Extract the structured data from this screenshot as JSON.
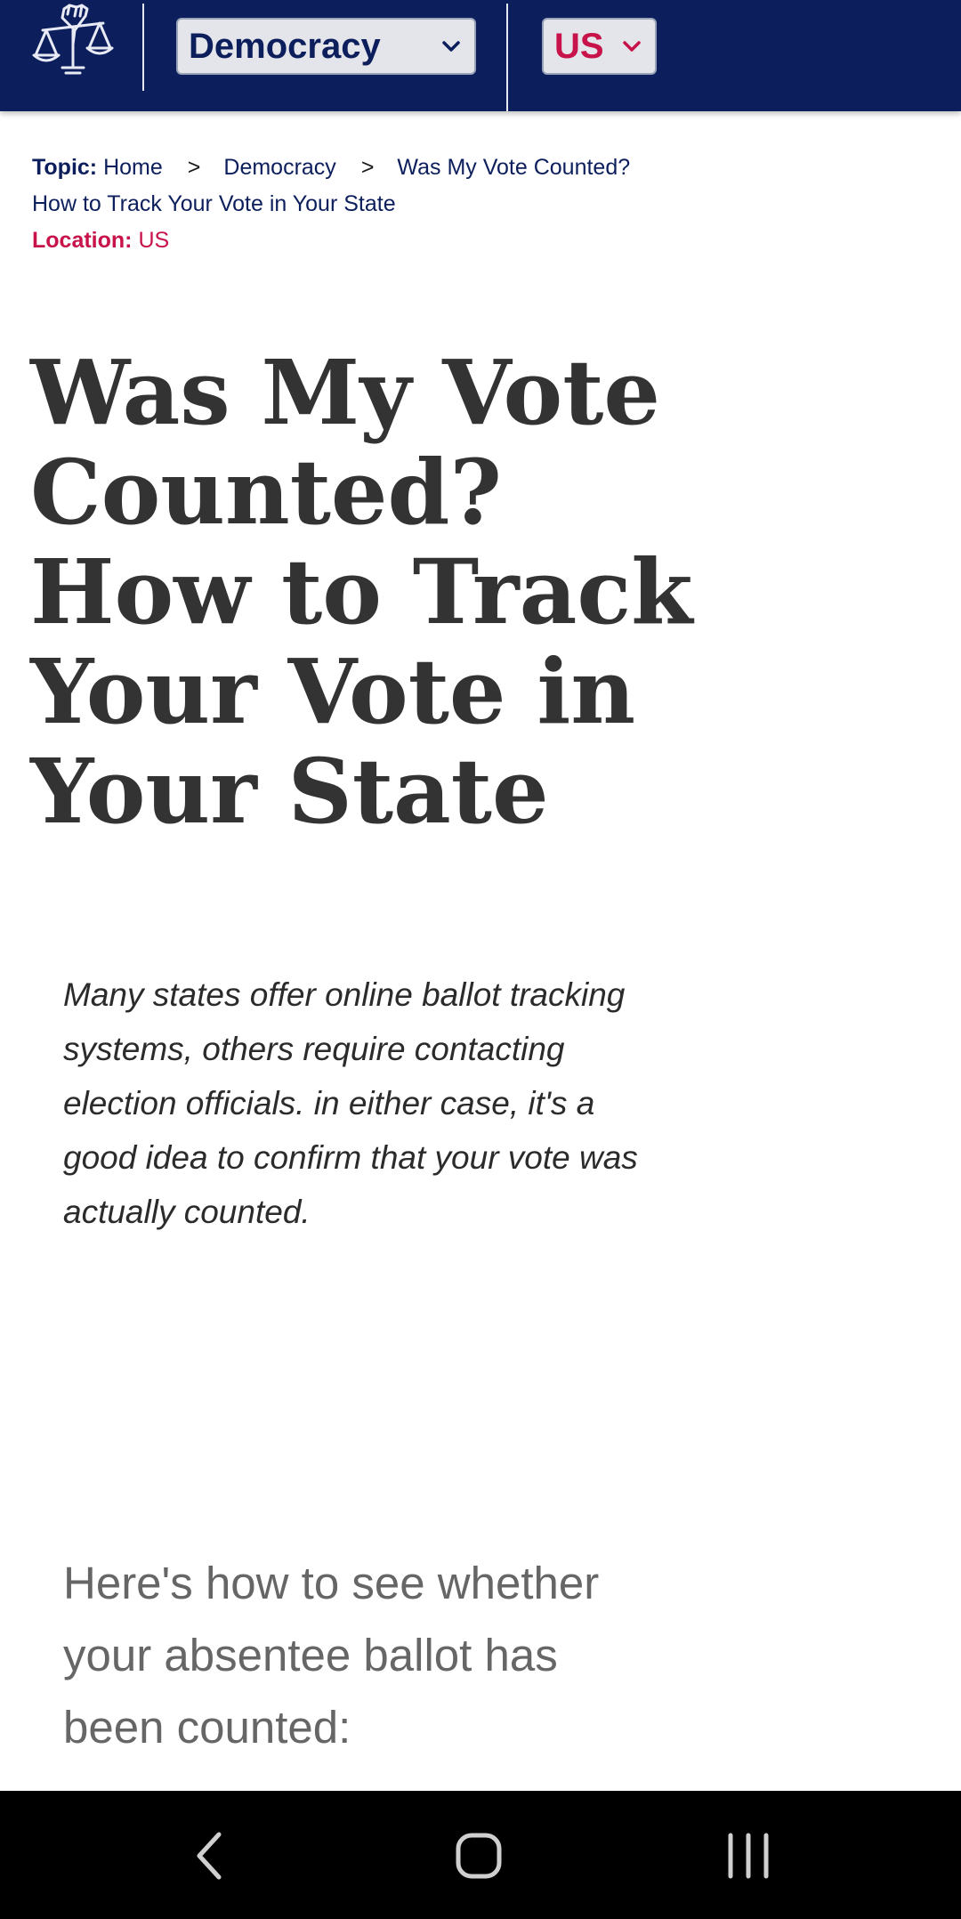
{
  "header": {
    "logo_icon": "scales-fist-icon",
    "topic_select": {
      "value": "Democracy"
    },
    "location_select": {
      "value": "US"
    }
  },
  "breadcrumb": {
    "topic_key": "Topic:",
    "items": [
      "Home",
      "Democracy",
      "Was My Vote Counted?"
    ],
    "separator": ">",
    "continuation": "How to Track Your Vote in Your State",
    "location_key": "Location:",
    "location_value": "US"
  },
  "article": {
    "title": "Was My Vote Counted? How to Track Your Vote in Your State",
    "intro": "Many states offer online ballot tracking systems, others require contacting election officials. in either case, it's a good idea to confirm that your vote was actually counted.",
    "lead": "Here's how to see whether your absentee ballot has been counted:"
  },
  "navbar": {
    "back_icon": "back-chevron-icon",
    "home_icon": "home-icon",
    "recents_icon": "recent-apps-icon"
  },
  "colors": {
    "header_bg": "#0c1f5c",
    "location_accent": "#c8134a",
    "title_text": "#333333"
  }
}
